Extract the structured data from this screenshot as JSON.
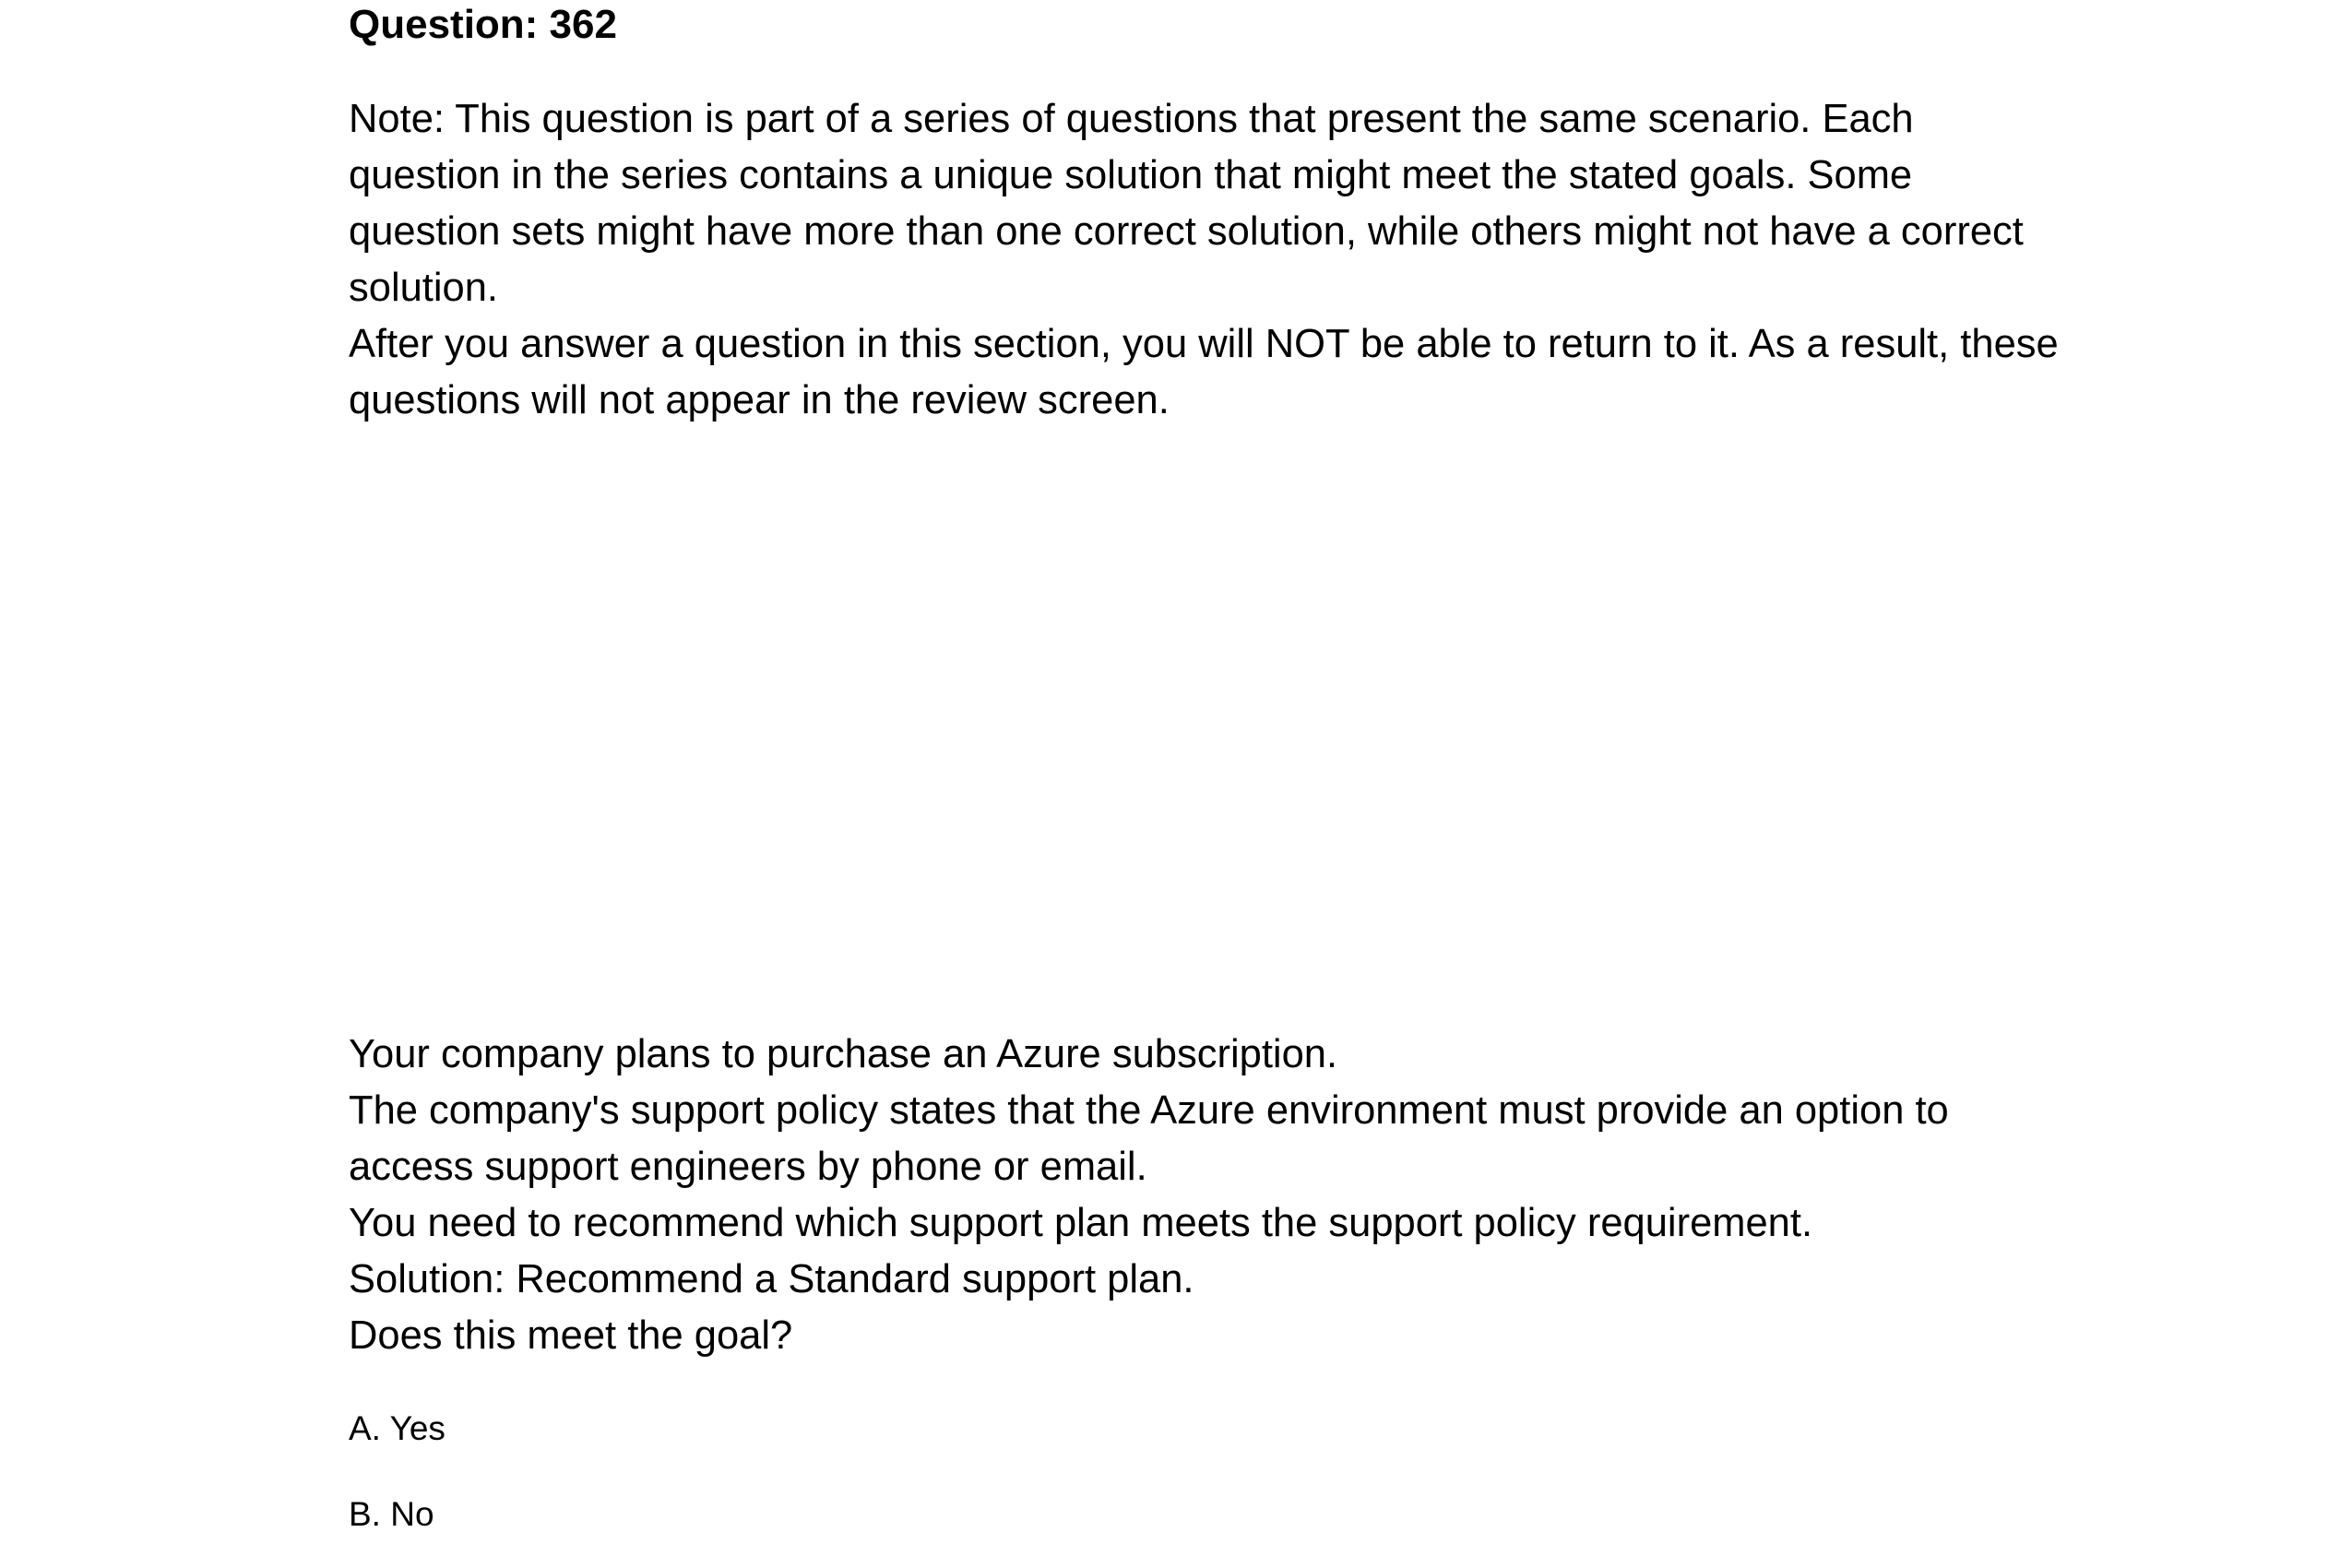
{
  "question": {
    "title": "Question: 362"
  },
  "note": {
    "paragraph1": "Note: This question is part of a series of questions that present the same scenario. Each question in the series contains a unique solution that might meet the stated goals. Some question sets might have more than one correct solution, while others might not have a correct solution.",
    "paragraph2": "After you answer a question in this section, you will NOT be able to return to it. As a result, these questions will not appear in the review screen."
  },
  "scenario": {
    "line1": "Your company plans to purchase an Azure subscription.",
    "line2": "The company's support policy states that the Azure environment must provide an option to access support engineers by phone or email.",
    "line3": "You need to recommend which support plan meets the support policy requirement.",
    "line4": "Solution: Recommend a Standard support plan.",
    "line5": "Does this meet the goal?"
  },
  "options": [
    {
      "label": "A. Yes"
    },
    {
      "label": "B. No"
    }
  ]
}
